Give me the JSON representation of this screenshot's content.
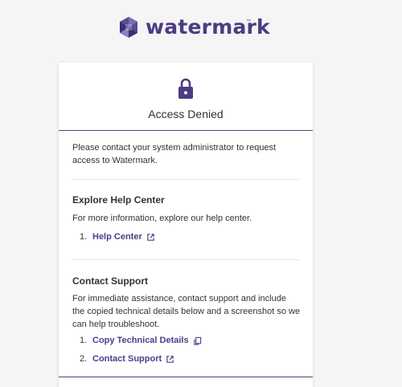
{
  "brand": {
    "logo_text": "watermark",
    "logo_icon": "watermark-logo-icon",
    "tm": "™",
    "color": "#4d3b85"
  },
  "card": {
    "lock_icon": "lock-icon",
    "title": "Access Denied",
    "intro": "Please contact your system administrator to request access to Watermark."
  },
  "help": {
    "title": "Explore Help Center",
    "text": "For more information, explore our help center.",
    "items": [
      {
        "num": "1.",
        "label": "Help Center",
        "icon": "external-link-icon"
      }
    ]
  },
  "support": {
    "title": "Contact Support",
    "text": "For immediate assistance, contact support and include the copied technical details below and a screenshot so we can help troubleshoot.",
    "items": [
      {
        "num": "1.",
        "label": "Copy Technical Details",
        "icon": "copy-icon"
      },
      {
        "num": "2.",
        "label": "Contact Support",
        "icon": "external-link-icon"
      }
    ]
  },
  "colors": {
    "accent": "#4a3f88",
    "background": "#f5f5f6",
    "card": "#ffffff"
  }
}
